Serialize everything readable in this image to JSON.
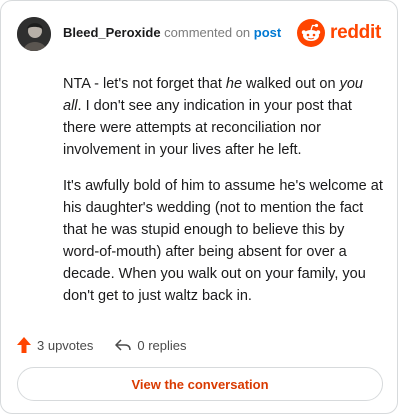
{
  "comment": {
    "username": "Bleed_Peroxide",
    "commented_text": "commented on",
    "post_link": "post",
    "paragraph1": {
      "a": "NTA - let's not forget that ",
      "he": "he",
      "b": " walked out on ",
      "you_all": "you all",
      "c": ". I don't see any indication in your post that there were attempts at reconciliation nor involvement in your lives after he left."
    },
    "paragraph2": "It's awfully bold of him to assume he's welcome at his daughter's wedding (not to mention the fact that he was stupid enough to believe this by word-of-mouth) after being absent for over a decade. When you walk out on your family, you don't get to just waltz back in."
  },
  "brand": {
    "name": "reddit",
    "color": "#ff4500"
  },
  "footer": {
    "upvotes": "3 upvotes",
    "replies": "0 replies",
    "upvote_icon_color": "#ff4500"
  },
  "cta": {
    "label": "View the conversation"
  },
  "icons": {
    "avatar": "user-avatar",
    "logo": "reddit-snoo-icon",
    "upvote": "upvote-arrow-icon",
    "reply": "reply-arrow-icon"
  }
}
